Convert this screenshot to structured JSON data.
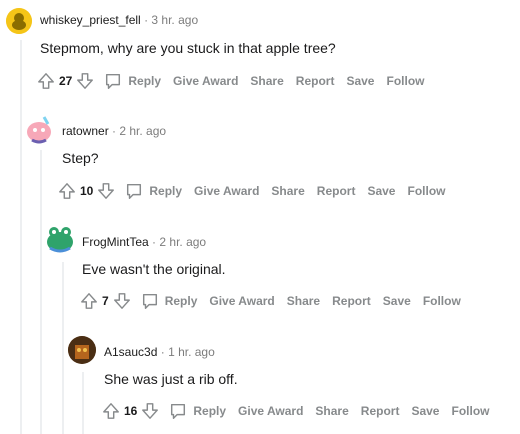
{
  "actions": {
    "reply": "Reply",
    "give_award": "Give Award",
    "share": "Share",
    "report": "Report",
    "save": "Save",
    "follow": "Follow"
  },
  "comments": [
    {
      "author": "whiskey_priest_fell",
      "time": "3 hr. ago",
      "text": "Stepmom, why are you stuck in that apple tree?",
      "score": "27",
      "avatar_icon": "snoo-avatar-icon",
      "avatar_color": "#f5c518"
    },
    {
      "author": "ratowner",
      "time": "2 hr. ago",
      "text": "Step?",
      "score": "10",
      "avatar_icon": "snoo-avatar-icon",
      "avatar_color": "#f7a8b8"
    },
    {
      "author": "FrogMintTea",
      "time": "2 hr. ago",
      "text": "Eve wasn't the original.",
      "score": "7",
      "avatar_icon": "snoo-avatar-icon",
      "avatar_color": "#2fa36b"
    },
    {
      "author": "A1sauc3d",
      "time": "1 hr. ago",
      "text": "She was just a rib off.",
      "score": "16",
      "avatar_icon": "snoo-avatar-icon",
      "avatar_color": "#b5651d"
    }
  ],
  "colors": {
    "meta_gray": "#7c7c7c",
    "action_gray": "#878a8c",
    "thread_line": "#edeff1"
  }
}
